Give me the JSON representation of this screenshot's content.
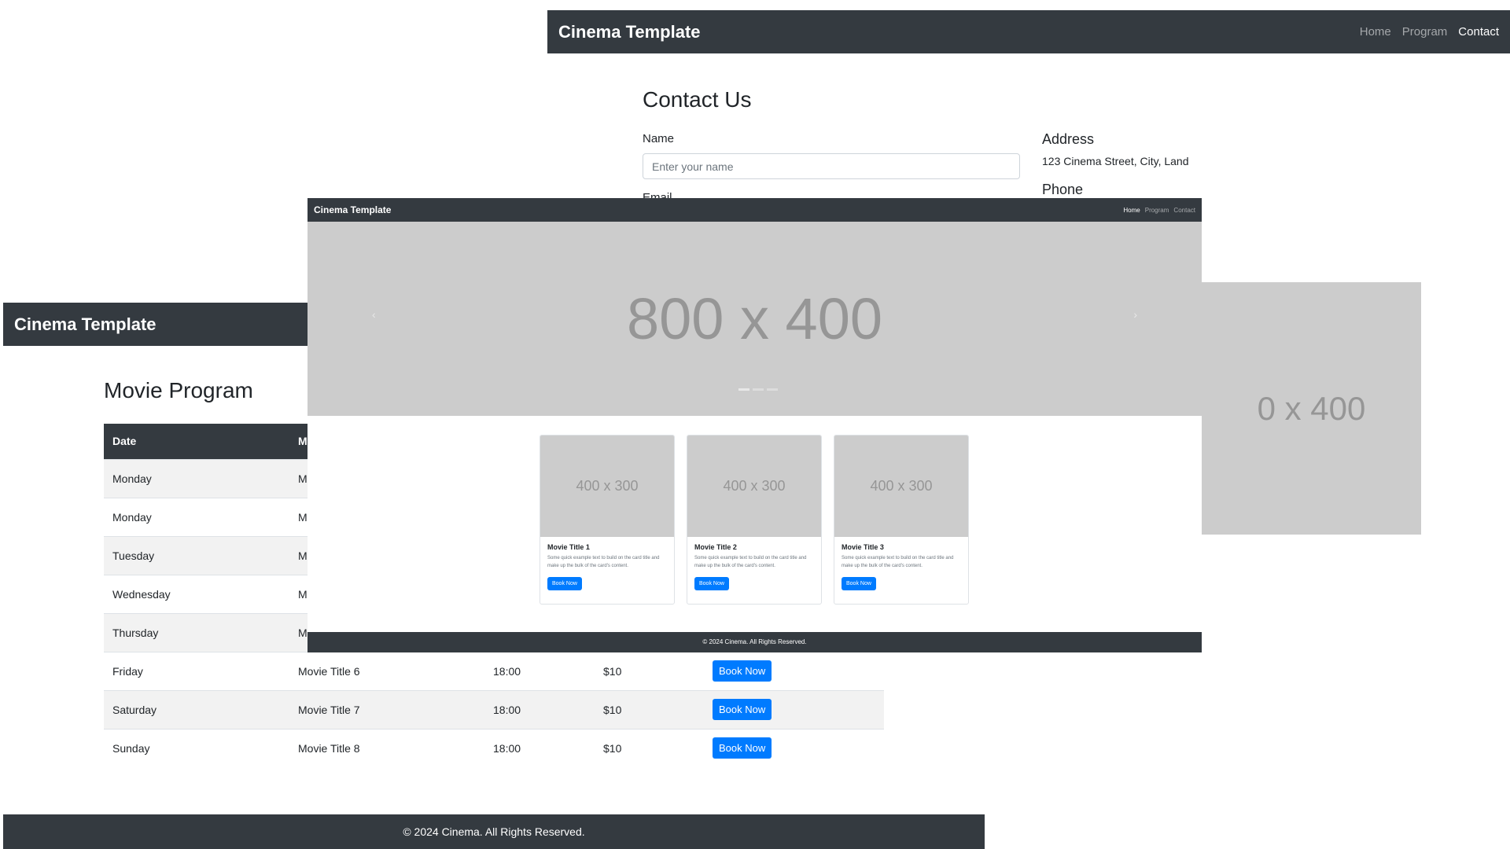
{
  "contact_window": {
    "brand": "Cinema Template",
    "nav": {
      "home": "Home",
      "program": "Program",
      "contact": "Contact"
    },
    "heading": "Contact Us",
    "name_label": "Name",
    "name_placeholder": "Enter your name",
    "email_label": "Email",
    "address_heading": "Address",
    "address_text": "123 Cinema Street, City, Land",
    "phone_heading": "Phone",
    "side_image": "0 x 400"
  },
  "program_window": {
    "brand": "Cinema Template",
    "heading": "Movie Program",
    "columns": [
      "Date",
      "M"
    ],
    "rows": [
      {
        "day": "Monday",
        "movie": "M",
        "time": "",
        "price": "",
        "button": ""
      },
      {
        "day": "Monday",
        "movie": "M",
        "time": "",
        "price": "",
        "button": ""
      },
      {
        "day": "Tuesday",
        "movie": "M",
        "time": "",
        "price": "",
        "button": ""
      },
      {
        "day": "Wednesday",
        "movie": "M",
        "time": "",
        "price": "",
        "button": ""
      },
      {
        "day": "Thursday",
        "movie": "M",
        "time": "",
        "price": "",
        "button": ""
      },
      {
        "day": "Friday",
        "movie": "Movie Title 6",
        "time": "18:00",
        "price": "$10",
        "button": "Book Now"
      },
      {
        "day": "Saturday",
        "movie": "Movie Title 7",
        "time": "18:00",
        "price": "$10",
        "button": "Book Now"
      },
      {
        "day": "Sunday",
        "movie": "Movie Title 8",
        "time": "18:00",
        "price": "$10",
        "button": "Book Now"
      }
    ],
    "footer": "© 2024 Cinema. All Rights Reserved."
  },
  "home_window": {
    "brand": "Cinema Template",
    "nav": {
      "home": "Home",
      "program": "Program",
      "contact": "Contact"
    },
    "carousel_image": "800 x 400",
    "carousel_prev": "‹",
    "carousel_next": "›",
    "cards": [
      {
        "image": "400 x 300",
        "title": "Movie Title 1",
        "text": "Some quick example text to build on the card title and make up the bulk of the card's content.",
        "button": "Book Now"
      },
      {
        "image": "400 x 300",
        "title": "Movie Title 2",
        "text": "Some quick example text to build on the card title and make up the bulk of the card's content.",
        "button": "Book Now"
      },
      {
        "image": "400 x 300",
        "title": "Movie Title 3",
        "text": "Some quick example text to build on the card title and make up the bulk of the card's content.",
        "button": "Book Now"
      }
    ],
    "footer": "© 2024 Cinema. All Rights Reserved."
  }
}
